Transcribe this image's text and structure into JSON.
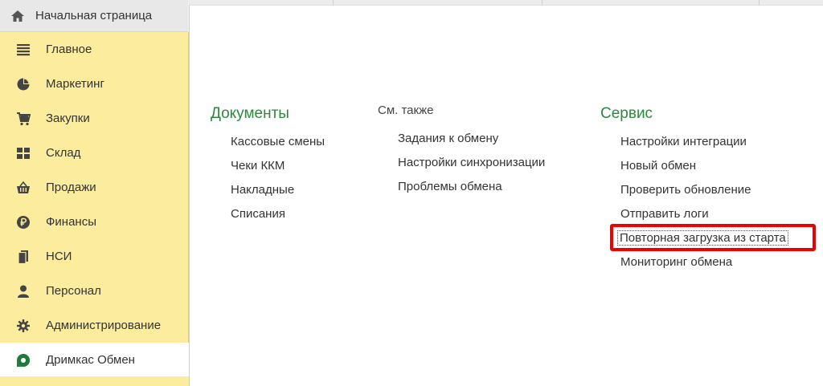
{
  "tabs": {
    "home_label": "Начальная страница"
  },
  "sidebar": {
    "items": [
      {
        "label": "Главное",
        "icon": "menu-lines-icon"
      },
      {
        "label": "Маркетинг",
        "icon": "pie-chart-icon"
      },
      {
        "label": "Закупки",
        "icon": "cart-icon"
      },
      {
        "label": "Склад",
        "icon": "warehouse-grid-icon"
      },
      {
        "label": "Продажи",
        "icon": "basket-icon"
      },
      {
        "label": "Финансы",
        "icon": "ruble-coin-icon"
      },
      {
        "label": "НСИ",
        "icon": "documents-icon"
      },
      {
        "label": "Персонал",
        "icon": "person-icon"
      },
      {
        "label": "Администрирование",
        "icon": "gear-icon"
      },
      {
        "label": "Дримкас Обмен",
        "icon": "dreamkas-logo-icon",
        "active": true
      }
    ]
  },
  "main": {
    "documents": {
      "title": "Документы",
      "links": [
        "Кассовые смены",
        "Чеки ККМ",
        "Накладные",
        "Списания"
      ]
    },
    "see_also": {
      "title": "См. также",
      "links": [
        "Задания к обмену",
        "Настройки синхронизации",
        "Проблемы обмена"
      ]
    },
    "service": {
      "title": "Сервис",
      "links": [
        "Настройки интеграции",
        "Новый обмен",
        "Проверить обновление",
        "Отправить логи",
        "Повторная загрузка из старта",
        "Мониторинг обмена"
      ]
    }
  },
  "colors": {
    "sidebar_bg": "#fbec9e",
    "section_title": "#2a8a3a",
    "highlight": "#ee0000"
  }
}
